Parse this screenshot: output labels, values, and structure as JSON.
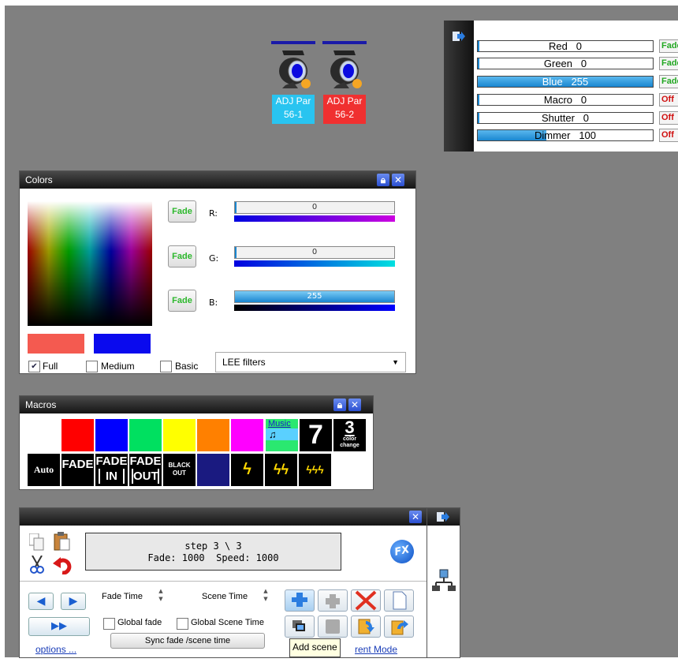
{
  "fixtures": [
    {
      "line1": "ADJ Par",
      "line2": "56-1",
      "color": "#29c4f0"
    },
    {
      "line1": "ADJ Par",
      "line2": "56-2",
      "color": "#f03030"
    }
  ],
  "channels": [
    {
      "label": "Red",
      "value": "0",
      "level": 0,
      "button": "Fade",
      "btn_type": "fade"
    },
    {
      "label": "Green",
      "value": "0",
      "level": 0,
      "button": "Fade",
      "btn_type": "fade"
    },
    {
      "label": "Blue",
      "value": "255",
      "level": 1,
      "button": "Fade",
      "btn_type": "fade"
    },
    {
      "label": "Macro",
      "value": "0",
      "level": 0,
      "button": "Off",
      "btn_type": "off"
    },
    {
      "label": "Shutter",
      "value": "0",
      "level": 0,
      "button": "Off",
      "btn_type": "off"
    },
    {
      "label": "Dimmer",
      "value": "100",
      "level": 0.39,
      "button": "Off",
      "btn_type": "off"
    }
  ],
  "colors_panel": {
    "title": "Colors",
    "sliders": [
      {
        "button": "Fade",
        "label": "R:",
        "value": "0",
        "level": 0
      },
      {
        "button": "Fade",
        "label": "G:",
        "value": "0",
        "level": 0
      },
      {
        "button": "Fade",
        "label": "B:",
        "value": "255",
        "level": 1
      }
    ],
    "swatch_left": "#f45a50",
    "swatch_right": "#0a0aee",
    "checkboxes": [
      {
        "label": "Full",
        "checked": true
      },
      {
        "label": "Medium",
        "checked": false
      },
      {
        "label": "Basic",
        "checked": false
      }
    ],
    "filter_select": "LEE filters"
  },
  "macros_panel": {
    "title": "Macros",
    "row1_colors": [
      "#ff0000",
      "#0000ff",
      "#00e060",
      "#ffff00",
      "#ff8000",
      "#ff00ff"
    ],
    "music_label": "Music",
    "music_note": "♫",
    "num7": "7",
    "num3": "3",
    "color_change": "color change",
    "auto": "Auto",
    "fade": "FADE",
    "fade_in_top": "FADE",
    "fade_in_bottom": "IN",
    "fade_out_top": "FADE",
    "fade_out_bottom": "OUT",
    "black_top": "BLACK",
    "black_bottom": "OUT",
    "strobe_1": "ϟ",
    "strobe_2": "ϟϟ",
    "strobe_3": "ϟϟϟ"
  },
  "scene_panel": {
    "step_line": "step 3 \\ 3",
    "fade_line": "Fade: 1000  Speed: 1000",
    "fade_time_label": "Fade Time",
    "scene_time_label": "Scene Time",
    "global_fade": "Global fade",
    "global_scene_time": "Global Scene Time",
    "sync_button": "Sync fade /scene time",
    "options_link": "options ...",
    "mode_link": "rent Mode",
    "tooltip": "Add scene",
    "fx_label": "FX"
  },
  "icons": [
    "export-icon",
    "copy-icon",
    "paste-icon",
    "cut-icon",
    "undo-icon",
    "lock-icon",
    "close-icon",
    "fx-icon",
    "add-scene-icon",
    "delete-icon",
    "new-icon",
    "network-icon"
  ]
}
